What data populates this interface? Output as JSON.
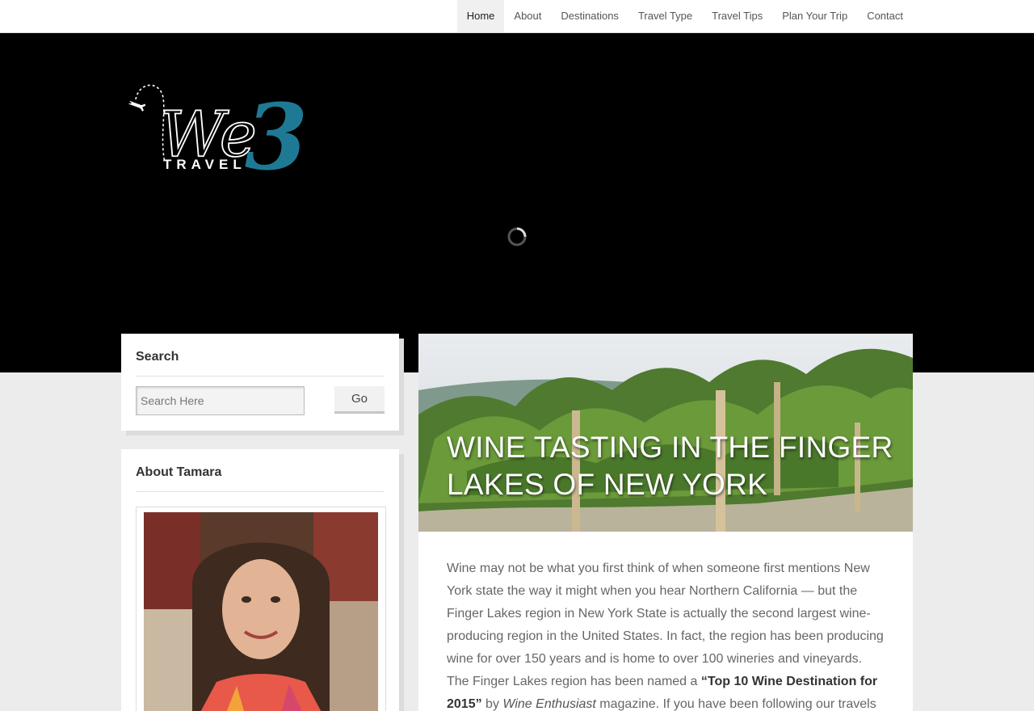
{
  "nav": {
    "items": [
      {
        "label": "Home",
        "active": true
      },
      {
        "label": "About"
      },
      {
        "label": "Destinations"
      },
      {
        "label": "Travel Type"
      },
      {
        "label": "Travel Tips"
      },
      {
        "label": "Plan Your Trip"
      },
      {
        "label": "Contact"
      }
    ]
  },
  "logo": {
    "script_text": "We",
    "number_text": "3",
    "sub_text": "TRAVEL",
    "accent": "#1e7a94"
  },
  "search_widget": {
    "title": "Search",
    "placeholder": "Search Here",
    "button_label": "Go"
  },
  "about_widget": {
    "title": "About Tamara"
  },
  "post": {
    "title": "WINE TASTING IN THE FINGER LAKES OF NEW YORK",
    "p1_a": "Wine may not be what you first think of when someone first mentions New York state the way it might when you hear Northern California — but the Finger Lakes region in New York State is actually the second largest wine-producing region in the United States. In fact, the region has been producing wine for over 150 years and is home to over 100 wineries and vineyards. The Finger Lakes region has been named a ",
    "p1_strong": "“Top 10 Wine Destination for 2015”",
    "p1_b": " by ",
    "p1_em": "Wine Enthusiast",
    "p1_c": " magazine. If you have been following our travels for a"
  },
  "icons": {
    "loading": "spinner-icon",
    "logo_plane": "airplane-icon"
  },
  "colors": {
    "hero_bg": "#000000",
    "accent": "#1e7a94",
    "page_bg": "#ececec"
  }
}
